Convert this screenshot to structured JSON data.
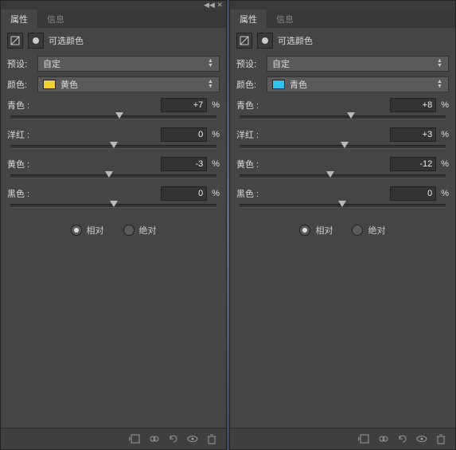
{
  "panels": [
    {
      "tabs": {
        "active": "属性",
        "inactive": "信息"
      },
      "title": "可选颜色",
      "preset": {
        "label": "预设:",
        "value": "自定"
      },
      "color": {
        "label": "颜色:",
        "value": "黄色",
        "swatch": "#f3d033"
      },
      "sliders": [
        {
          "label": "青色 :",
          "value": "+7",
          "pos": 53
        },
        {
          "label": "洋红 :",
          "value": "0",
          "pos": 50
        },
        {
          "label": "黄色 :",
          "value": "-3",
          "pos": 48
        },
        {
          "label": "黑色 :",
          "value": "0",
          "pos": 50
        }
      ],
      "method": {
        "relative": "相对",
        "absolute": "绝对",
        "selected": "relative"
      },
      "suffix": "%"
    },
    {
      "tabs": {
        "active": "属性",
        "inactive": "信息"
      },
      "title": "可选颜色",
      "preset": {
        "label": "预设:",
        "value": "自定"
      },
      "color": {
        "label": "颜色:",
        "value": "青色",
        "swatch": "#2fc4ef"
      },
      "sliders": [
        {
          "label": "青色 :",
          "value": "+8",
          "pos": 54
        },
        {
          "label": "洋红 :",
          "value": "+3",
          "pos": 51
        },
        {
          "label": "黄色 :",
          "value": "-12",
          "pos": 44
        },
        {
          "label": "黑色 :",
          "value": "0",
          "pos": 50
        }
      ],
      "method": {
        "relative": "相对",
        "absolute": "绝对",
        "selected": "relative"
      },
      "suffix": "%"
    }
  ],
  "icons": {
    "adjustment": "adjustment-icon",
    "mask": "mask-icon",
    "clip": "clip-icon",
    "prev": "view-previous-icon",
    "reset": "reset-icon",
    "visibility": "visibility-icon",
    "trash": "trash-icon"
  }
}
